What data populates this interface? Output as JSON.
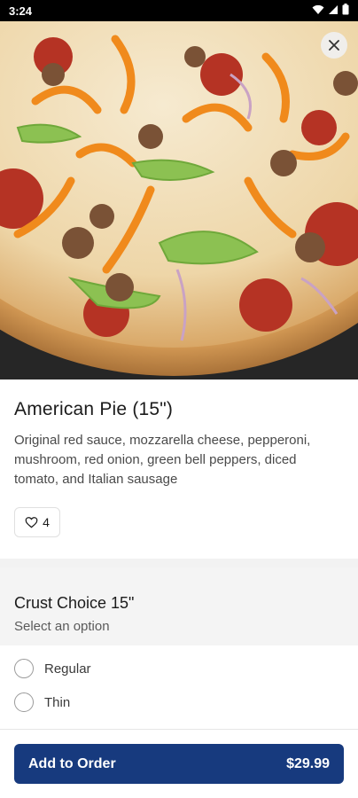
{
  "status_bar": {
    "time": "3:24",
    "icons": [
      "wifi-icon",
      "signal-icon",
      "battery-icon"
    ]
  },
  "hero": {
    "image_subject": "pizza",
    "close_icon": "close-icon"
  },
  "item": {
    "title": "American Pie (15\")",
    "description": "Original red sauce, mozzarella cheese, pepperoni, mushroom, red onion, green bell peppers, diced tomato, and Italian sausage",
    "likes": "4",
    "like_icon": "heart-icon"
  },
  "options": {
    "title": "Crust Choice 15\"",
    "subtitle": "Select an option",
    "choices": [
      {
        "label": "Regular",
        "selected": false
      },
      {
        "label": "Thin",
        "selected": false
      }
    ]
  },
  "footer": {
    "add_label": "Add to Order",
    "price": "$29.99"
  },
  "colors": {
    "primary": "#173a7e",
    "status_bar": "#000000",
    "section_bg": "#f4f4f4"
  }
}
